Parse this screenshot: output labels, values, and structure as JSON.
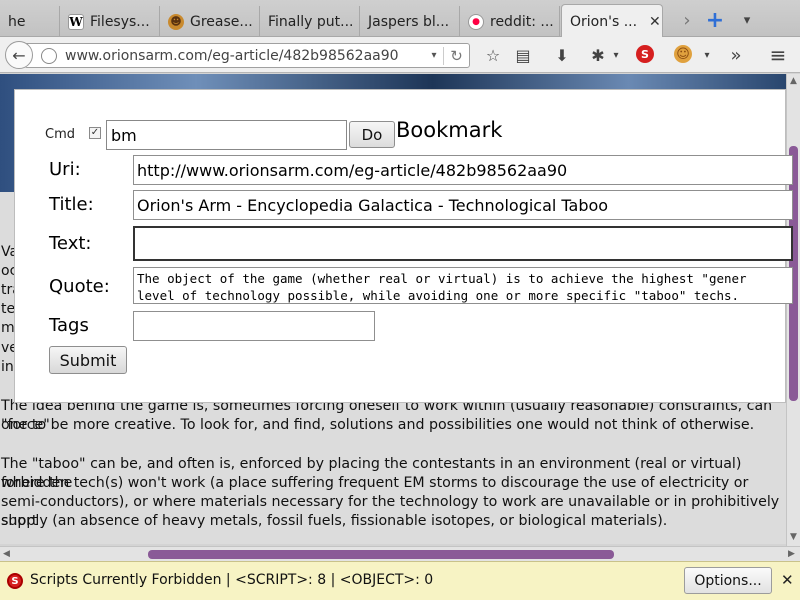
{
  "tabs": [
    {
      "label": "he",
      "icon": "none"
    },
    {
      "label": "Filesys...",
      "icon": "wikipedia-icon"
    },
    {
      "label": "Grease...",
      "icon": "greasemonkey-icon"
    },
    {
      "label": "Finally put...",
      "icon": "none"
    },
    {
      "label": "Jaspers bl...",
      "icon": "none"
    },
    {
      "label": "reddit: ...",
      "icon": "reddit-icon"
    },
    {
      "label": "Orion's ...",
      "icon": "none",
      "active": true
    }
  ],
  "tabbar": {
    "close": "✕",
    "next": "›",
    "new_tab": "+",
    "list": "▾"
  },
  "navbar": {
    "back": "←",
    "url": "www.orionsarm.com/eg-article/482b98562aa90",
    "url_dropdown": "▾",
    "reload": "↻",
    "bookmark_star": "☆",
    "reading_list": "▤",
    "downloads": "⬇",
    "addon": "✱",
    "addon_dd": "▾",
    "noscript": "S",
    "greasemonkey": "☺",
    "gm_dd": "▾",
    "overflow": "»",
    "menu": "≡"
  },
  "dialog": {
    "cmd_label": "Cmd",
    "cmd_checked": "✓",
    "cmd_value": "bm",
    "do_label": "Do",
    "title": "Bookmark",
    "uri_label": "Uri:",
    "uri_value": "http://www.orionsarm.com/eg-article/482b98562aa90",
    "title_label": "Title:",
    "title_value": "Orion's Arm - Encyclopedia Galactica - Technological Taboo",
    "text_label": "Text:",
    "text_value": "",
    "quote_label": "Quote:",
    "quote_value": "The object of the game (whether real or virtual) is to achieve the highest \"gener\nlevel of technology possible, while avoiding one or more specific \"taboo\" techs.",
    "tags_label": "Tags",
    "tags_value": "",
    "submit_label": "Submit"
  },
  "page": {
    "side_fragments": [
      "Va",
      "oc",
      "tra",
      "te",
      "m",
      "ve",
      "int"
    ],
    "para1_line1": "The idea behind the game is, sometimes forcing oneself to work within (usually reasonable) constraints, can \"force\"",
    "para1_line2": "one to be more creative. To look for, and find, solutions and possibilities one would not think of otherwise.",
    "para2_line1": "The \"taboo\" can be, and often is, enforced by placing the contestants in an environment (real or virtual) where the",
    "para2_line2": "forbidden tech(s) won't work (a place suffering frequent EM storms to discourage the use of electricity or",
    "para2_line3": "semi-conductors), or where materials necessary for the technology to work are unavailable or in prohibitively short",
    "para2_line4": "supply (an absence of heavy metals, fossil fuels, fissionable isotopes, or biological materials)."
  },
  "scrollbar": {
    "left": "◀",
    "right": "▶",
    "up": "▲",
    "down": "▼"
  },
  "notification": {
    "icon": "S",
    "text": "Scripts Currently Forbidden | <SCRIPT>: 8 | <OBJECT>: 0",
    "options_label": "Options...",
    "close": "✕"
  },
  "colors": {
    "accent_scroll": "#8a5a97",
    "notify_bg": "#f7f3c4",
    "noscript_red": "#d61f1f"
  }
}
